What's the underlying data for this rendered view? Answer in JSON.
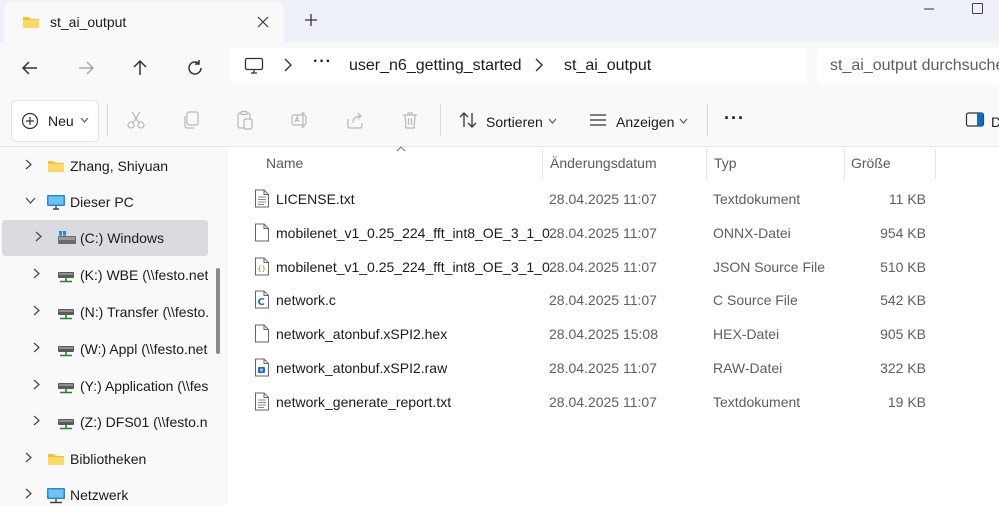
{
  "window": {
    "tab_title": "st_ai_output",
    "tab_close_icon": "close-icon",
    "new_tab_icon": "plus-icon"
  },
  "nav": {
    "back_icon": "arrow-left-icon",
    "forward_icon": "arrow-right-icon",
    "up_icon": "arrow-up-icon",
    "refresh_icon": "refresh-icon",
    "breadcrumb": {
      "root_icon": "monitor-icon",
      "ellipsis": "···",
      "items": [
        "user_n6_getting_started",
        "st_ai_output"
      ]
    },
    "search_placeholder": "st_ai_output durchsuchen"
  },
  "toolbar": {
    "new_label": "Neu",
    "sort_label": "Sortieren",
    "view_label": "Anzeigen",
    "more_label": "···",
    "right_label": "D"
  },
  "sidebar": {
    "items": [
      {
        "label": "Zhang, Shiyuan",
        "icon": "folder-icon"
      },
      {
        "label": "Dieser PC",
        "icon": "monitor-icon"
      },
      {
        "label": "(C:) Windows",
        "icon": "drive-icon"
      },
      {
        "label": "(K:) WBE (\\\\festo.net\\",
        "icon": "network-drive-icon"
      },
      {
        "label": "(N:) Transfer (\\\\festo.n",
        "icon": "network-drive-icon"
      },
      {
        "label": "(W:) Appl (\\\\festo.net",
        "icon": "network-drive-icon"
      },
      {
        "label": "(Y:) Application (\\\\fes",
        "icon": "network-drive-icon"
      },
      {
        "label": "(Z:) DFS01 (\\\\festo.ne",
        "icon": "network-drive-icon"
      },
      {
        "label": "Bibliotheken",
        "icon": "library-icon"
      },
      {
        "label": "Netzwerk",
        "icon": "network-icon"
      }
    ]
  },
  "columns": {
    "name": "Name",
    "date": "Änderungsdatum",
    "type": "Typ",
    "size": "Größe"
  },
  "files": [
    {
      "name": "LICENSE.txt",
      "date": "28.04.2025 11:07",
      "type": "Textdokument",
      "size": "11 KB",
      "icon": "text-file-icon"
    },
    {
      "name": "mobilenet_v1_0.25_224_fft_int8_OE_3_1_0...",
      "date": "28.04.2025 11:07",
      "type": "ONNX-Datei",
      "size": "954 KB",
      "icon": "file-icon"
    },
    {
      "name": "mobilenet_v1_0.25_224_fft_int8_OE_3_1_0...",
      "date": "28.04.2025 11:07",
      "type": "JSON Source File",
      "size": "510 KB",
      "icon": "json-file-icon"
    },
    {
      "name": "network.c",
      "date": "28.04.2025 11:07",
      "type": "C Source File",
      "size": "542 KB",
      "icon": "c-file-icon"
    },
    {
      "name": "network_atonbuf.xSPI2.hex",
      "date": "28.04.2025 15:08",
      "type": "HEX-Datei",
      "size": "905 KB",
      "icon": "file-icon"
    },
    {
      "name": "network_atonbuf.xSPI2.raw",
      "date": "28.04.2025 11:07",
      "type": "RAW-Datei",
      "size": "322 KB",
      "icon": "raw-file-icon"
    },
    {
      "name": "network_generate_report.txt",
      "date": "28.04.2025 11:07",
      "type": "Textdokument",
      "size": "19 KB",
      "icon": "text-file-icon"
    }
  ]
}
